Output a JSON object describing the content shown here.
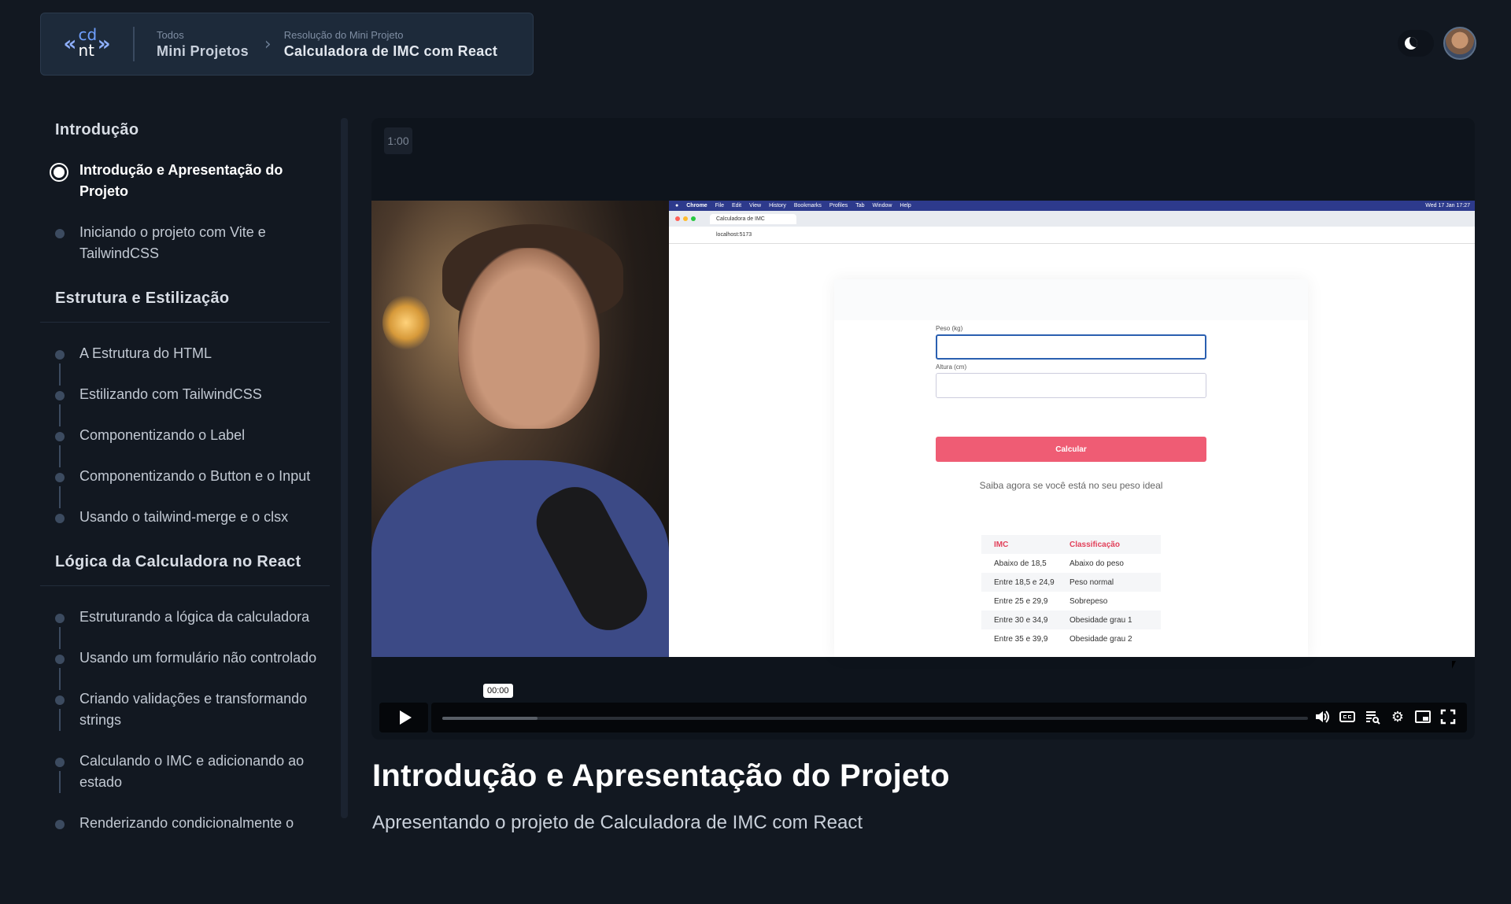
{
  "header": {
    "logo_text_top": "cd",
    "logo_text_bottom": "nt",
    "crumb1_small": "Todos",
    "crumb1_big": "Mini Projetos",
    "crumb2_small": "Resolução do Mini Projeto",
    "crumb2_big": "Calculadora de IMC com React"
  },
  "sidebar": {
    "sections": [
      {
        "title": "Introdução",
        "lessons": [
          {
            "label": "Introdução e Apresentação do Projeto",
            "active": true
          },
          {
            "label": "Iniciando o projeto com Vite e TailwindCSS",
            "active": false
          }
        ]
      },
      {
        "title": "Estrutura e Estilização",
        "lessons": [
          {
            "label": "A Estrutura do HTML",
            "active": false
          },
          {
            "label": "Estilizando com TailwindCSS",
            "active": false
          },
          {
            "label": "Componentizando o Label",
            "active": false
          },
          {
            "label": "Componentizando o Button e o Input",
            "active": false
          },
          {
            "label": "Usando o tailwind-merge e o clsx",
            "active": false
          }
        ]
      },
      {
        "title": "Lógica da Calculadora no React",
        "lessons": [
          {
            "label": "Estruturando a lógica da calculadora",
            "active": false
          },
          {
            "label": "Usando um formulário não controlado",
            "active": false
          },
          {
            "label": "Criando validações e transformando strings",
            "active": false
          },
          {
            "label": "Calculando o IMC e adicionando ao estado",
            "active": false
          },
          {
            "label": "Renderizando condicionalmente o",
            "active": false
          }
        ]
      }
    ]
  },
  "player": {
    "timecode": "1:00",
    "tooltip_time": "00:00",
    "buffer_fraction": 0.11,
    "screen": {
      "menu": [
        "Chrome",
        "File",
        "Edit",
        "View",
        "History",
        "Bookmarks",
        "Profiles",
        "Tab",
        "Window",
        "Help"
      ],
      "clock": "Wed 17 Jan 17:27",
      "tab_title": "Calculadora de IMC",
      "url": "localhost:5173",
      "weight_label": "Peso (kg)",
      "height_label": "Altura (cm)",
      "button_label": "Calcular",
      "hint": "Saiba agora se você está no seu peso ideal",
      "table_headers": [
        "IMC",
        "Classificação"
      ],
      "table_rows": [
        [
          "Abaixo de 18,5",
          "Abaixo do peso"
        ],
        [
          "Entre 18,5 e 24,9",
          "Peso normal"
        ],
        [
          "Entre 25 e 29,9",
          "Sobrepeso"
        ],
        [
          "Entre 30 e 34,9",
          "Obesidade grau 1"
        ],
        [
          "Entre 35 e 39,9",
          "Obesidade grau 2"
        ]
      ]
    }
  },
  "lesson": {
    "title": "Introdução e Apresentação do Projeto",
    "subtitle": "Apresentando o projeto de Calculadora de IMC com React"
  }
}
